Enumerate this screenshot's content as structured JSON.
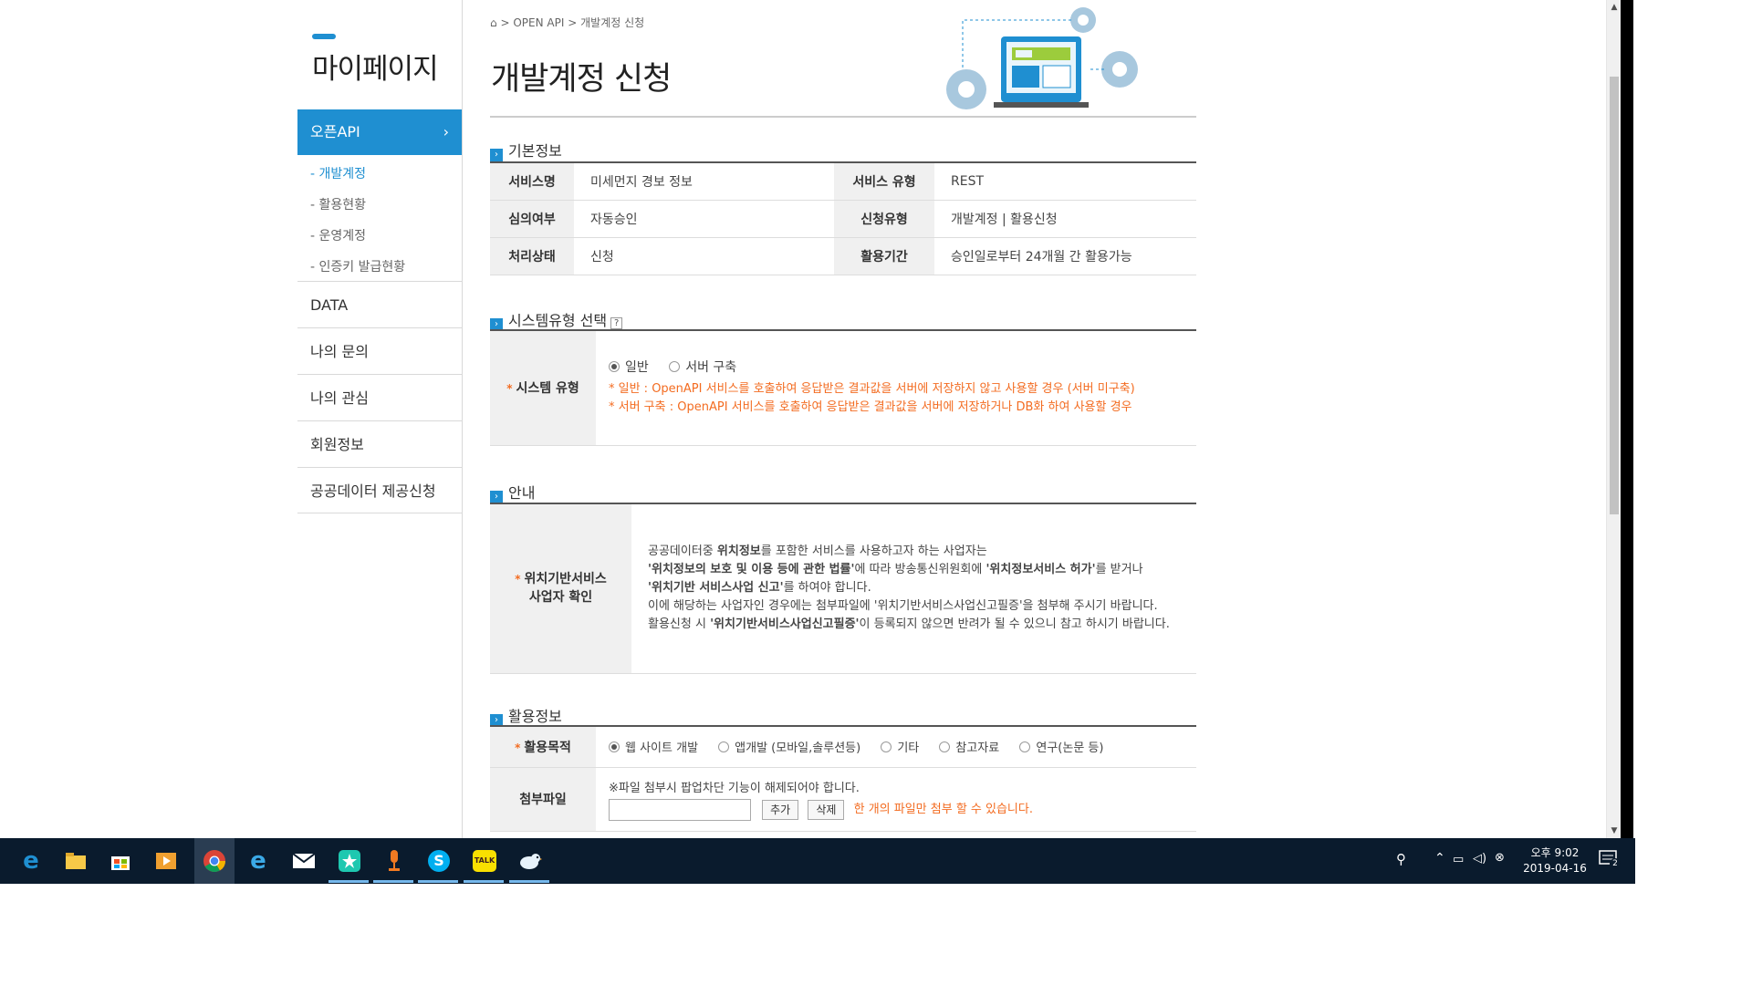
{
  "sidebar": {
    "title": "마이페이지",
    "active_menu": "오픈API",
    "sub_items": [
      "- 개발계정",
      "- 활용현황",
      "- 운영계정",
      "- 인증키 발급현황"
    ],
    "menus": [
      "DATA",
      "나의 문의",
      "나의 관심",
      "회원정보",
      "공공데이터 제공신청"
    ]
  },
  "breadcrumb": {
    "home_icon": "home-icon",
    "items": [
      "OPEN API",
      "개발계정 신청"
    ],
    "separator": ">"
  },
  "page_title": "개발계정 신청",
  "basic_info": {
    "heading": "기본정보",
    "rows": [
      {
        "label1": "서비스명",
        "value1": "미세먼지 경보 정보",
        "label2": "서비스 유형",
        "value2": "REST"
      },
      {
        "label1": "심의여부",
        "value1": "자동승인",
        "label2": "신청유형",
        "value2": "개발계정 | 활용신청"
      },
      {
        "label1": "처리상태",
        "value1": "신청",
        "label2": "활용기간",
        "value2": "승인일로부터 24개월 간 활용가능"
      }
    ]
  },
  "system_type": {
    "heading": "시스템유형 선택",
    "help": "?",
    "label": "시스템 유형",
    "options": [
      "일반",
      "서버 구축"
    ],
    "selected": "일반",
    "note1": "* 일반 : OpenAPI 서비스를 호출하여 응답받은 결과값을 서버에 저장하지 않고 사용할 경우 (서버 미구축)",
    "note2": "* 서버 구축 : OpenAPI 서비스를 호출하여 응답받은 결과값을 서버에 저장하거나 DB화 하여 사용할 경우"
  },
  "notice": {
    "heading": "안내",
    "label_line1": "위치기반서비스",
    "label_line2": "사업자 확인",
    "p1_a": "공공데이터중 ",
    "p1_b": "위치정보",
    "p1_c": "를 포함한 서비스를 사용하고자 하는 사업자는",
    "p2_a": "'위치정보의 보호 및 이용 등에 관한 법률'",
    "p2_b": "에 따라 방송통신위원회에 ",
    "p2_c": "'위치정보서비스 허가'",
    "p2_d": "를 받거나",
    "p3_a": "'위치기반 서비스사업 신고'",
    "p3_b": "를 하여야 합니다.",
    "p4": "이에 해당하는 사업자인 경우에는 첨부파일에 '위치기반서비스사업신고필증'을 첨부해 주시기 바랍니다.",
    "p5_a": "활용신청 시 ",
    "p5_b": "'위치기반서비스사업신고필증'",
    "p5_c": "이 등록되지 않으면 반려가 될 수 있으니 참고 하시기 바랍니다."
  },
  "usage_info": {
    "heading": "활용정보",
    "purpose_label": "활용목적",
    "purpose_options": [
      "웹 사이트 개발",
      "앱개발 (모바일,솔루션등)",
      "기타",
      "참고자료",
      "연구(논문 등)"
    ],
    "purpose_selected": "웹 사이트 개발",
    "attach_label": "첨부파일",
    "attach_note": "※파일 첨부시 팝업차단 기능이 해제되어야 합니다.",
    "add_button": "추가",
    "delete_button": "삭제",
    "attach_limit": "한 개의 파일만 첨부 할 수 있습니다."
  },
  "taskbar": {
    "apps": [
      "edge-icon",
      "file-explorer-icon",
      "store-icon",
      "media-player-icon",
      "chrome-icon",
      "internet-explorer-icon",
      "mail-icon",
      "app-star-icon",
      "app-microphone-icon",
      "skype-icon",
      "kakaotalk-icon",
      "app-bird-icon"
    ],
    "kakaotalk_label": "TALK",
    "skype_label": "S",
    "clock_time": "오후 9:02",
    "clock_date": "2019-04-16",
    "notification_count": "2"
  },
  "colors": {
    "accent": "#1f8fd1",
    "notice_red": "#e8131b",
    "note_orange": "#f36c21",
    "taskbar": "#0a1b2d"
  }
}
